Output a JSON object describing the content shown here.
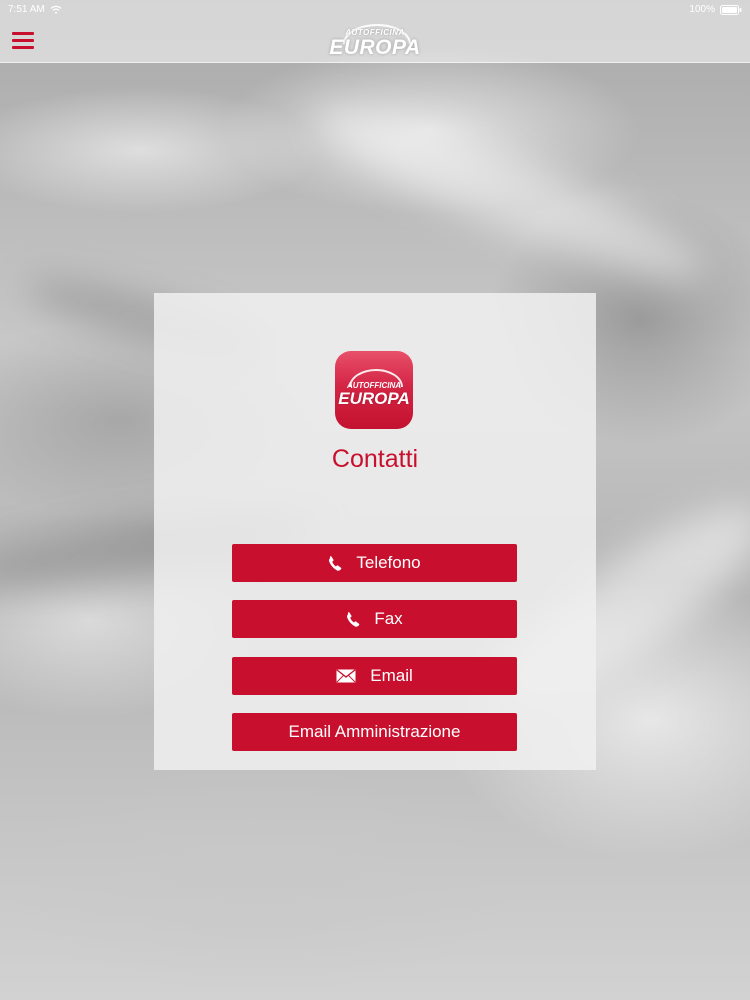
{
  "status_bar": {
    "time_left": "7:51 AM",
    "center_text": "",
    "battery_text": "100%",
    "wifi_icon": "wifi-icon",
    "battery_icon": "battery-icon"
  },
  "nav": {
    "menu_icon": "hamburger-menu-icon",
    "logo_small": "AUTOFFICINA",
    "logo_big": "EUROPA",
    "accent_color": "#c8102e"
  },
  "card": {
    "app_icon_small": "AUTOFFICINA",
    "app_icon_big": "EUROPA",
    "title": "Contatti"
  },
  "buttons": [
    {
      "label": "Telefono",
      "icon": "phone-icon"
    },
    {
      "label": "Fax",
      "icon": "phone-icon"
    },
    {
      "label": "Email",
      "icon": "envelope-icon"
    },
    {
      "label": "Email Amministrazione",
      "icon": ""
    }
  ]
}
